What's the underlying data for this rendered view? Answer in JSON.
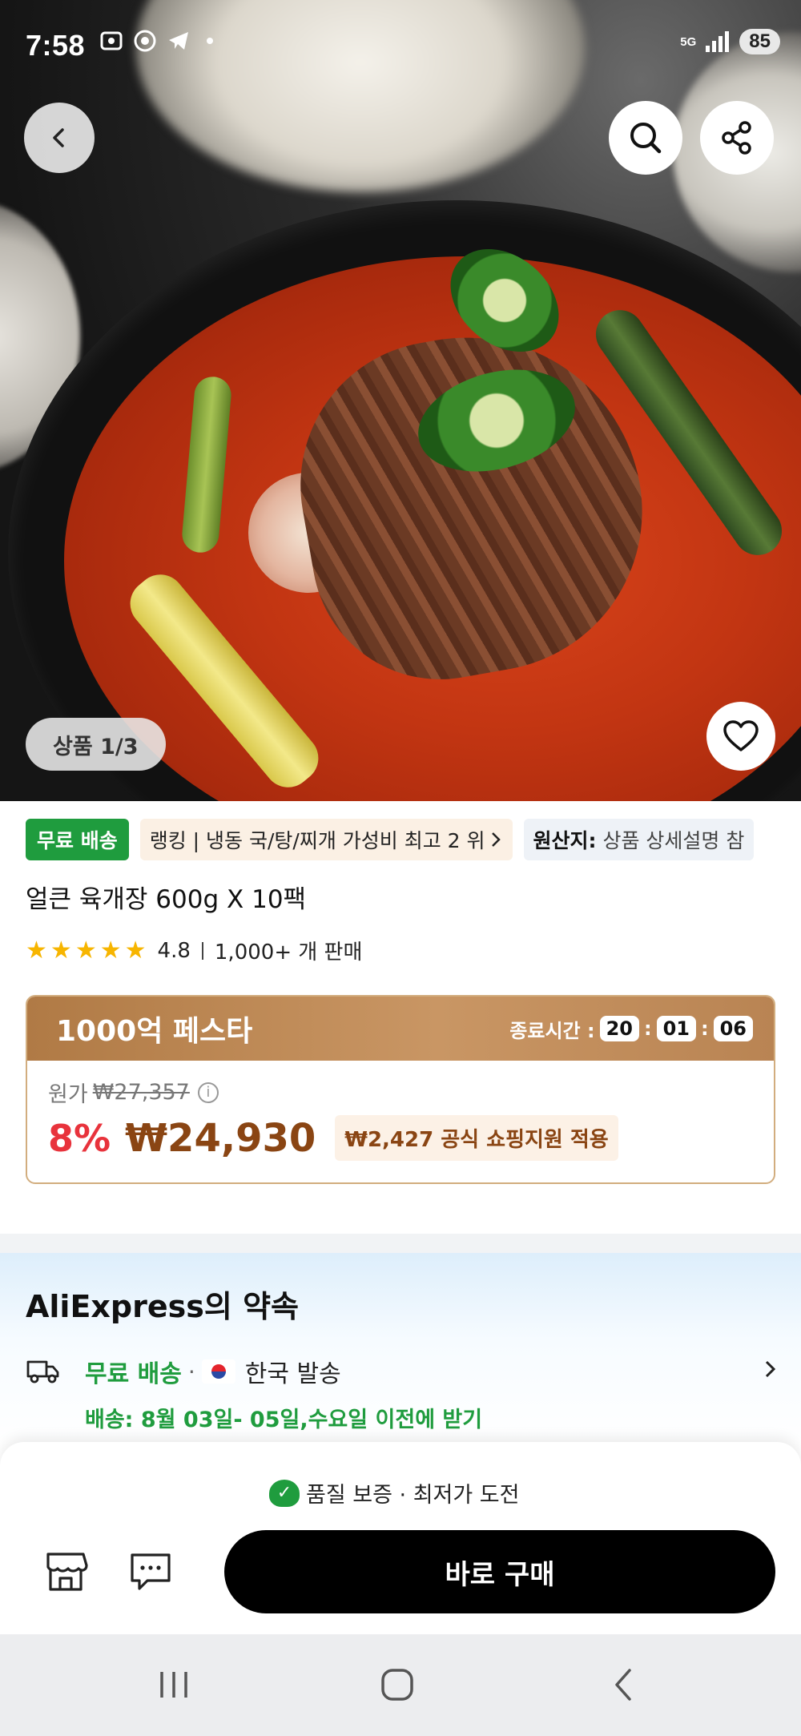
{
  "status_bar": {
    "time": "7:58",
    "network": "5G",
    "battery": "85"
  },
  "product_image": {
    "counter": "상품 1/3"
  },
  "tags": {
    "free_shipping": "무료 배송",
    "ranking": "랭킹 | 냉동 국/탕/찌개 가성비 최고 2 위",
    "origin_label": "원산지:",
    "origin_value": "상품 상세설명 참"
  },
  "product": {
    "title": "얼큰 육개장 600g X 10팩",
    "rating": "4.8",
    "rating_stars": 4.8,
    "sold": "1,000+ 개 판매"
  },
  "festa": {
    "title": "1000억 페스타",
    "timer_label": "종료시간 :",
    "timer": [
      "20",
      "01",
      "06"
    ],
    "original_label": "원가",
    "original_price": "₩27,357",
    "discount": "8%",
    "price": "₩24,930",
    "coupon": "₩2,427 공식 쇼핑지원 적용"
  },
  "promise": {
    "title": "AliExpress의 약속",
    "free_shipping": "무료 배송",
    "ship_from": "한국 발송",
    "delivery": "배송: 8월 03일- 05일,수요일 이전에 받기"
  },
  "bottom_bar": {
    "quality": "품질 보증 · 최저가 도전",
    "buy_now": "바로 구매"
  },
  "colors": {
    "green": "#1f9c3e",
    "red": "#e8333c",
    "brown": "#8a4513",
    "black": "#000000"
  }
}
